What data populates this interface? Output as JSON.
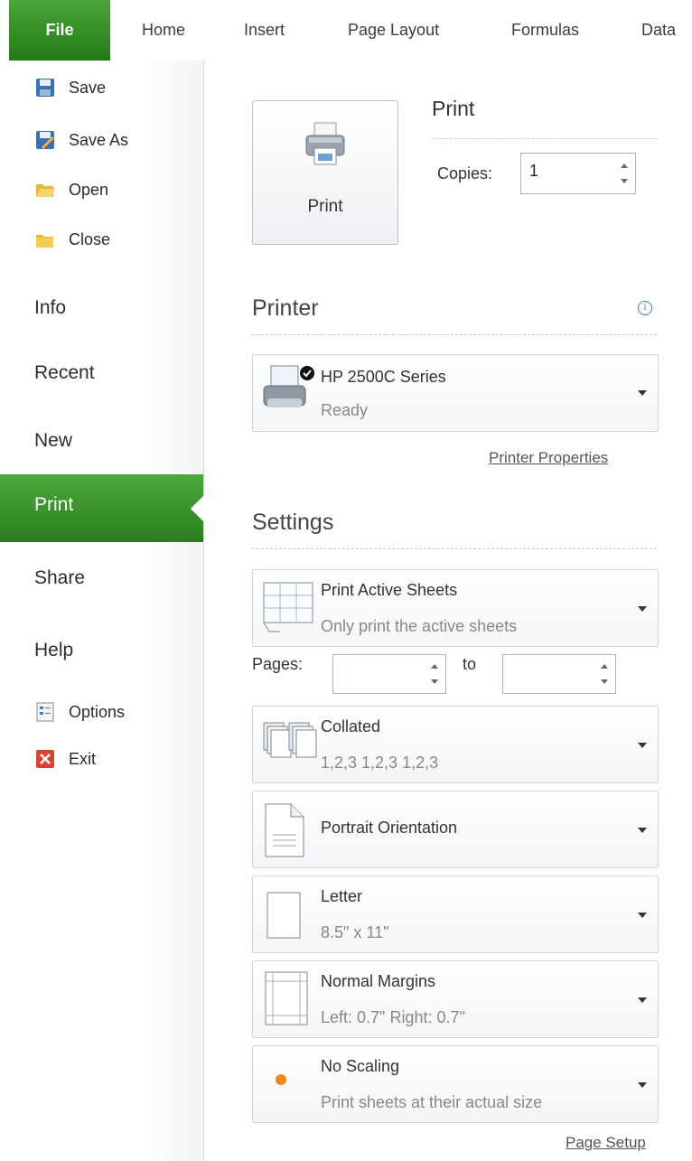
{
  "ribbon": {
    "tabs": [
      "File",
      "Home",
      "Insert",
      "Page Layout",
      "Formulas",
      "Data"
    ]
  },
  "backstage": {
    "commands": [
      {
        "label": "Save",
        "icon": "save-icon"
      },
      {
        "label": "Save As",
        "icon": "save-as-icon"
      },
      {
        "label": "Open",
        "icon": "open-folder-icon"
      },
      {
        "label": "Close",
        "icon": "close-folder-icon"
      }
    ],
    "nav": [
      "Info",
      "Recent",
      "New",
      "Print",
      "Share",
      "Help"
    ],
    "selected_nav": "Print",
    "bottom_commands": [
      {
        "label": "Options",
        "icon": "options-icon"
      },
      {
        "label": "Exit",
        "icon": "exit-icon"
      }
    ]
  },
  "print": {
    "button_label": "Print",
    "heading": "Print",
    "copies_label": "Copies:",
    "copies_value": "1"
  },
  "printer": {
    "heading": "Printer",
    "name": "HP 2500C Series",
    "status": "Ready",
    "properties_link": "Printer Properties"
  },
  "settings": {
    "heading": "Settings",
    "what_to_print": {
      "title": "Print Active Sheets",
      "subtitle": "Only print the active sheets"
    },
    "pages_label": "Pages:",
    "pages_from": "",
    "to_label": "to",
    "pages_to": "",
    "collation": {
      "title": "Collated",
      "subtitle": "1,2,3   1,2,3   1,2,3"
    },
    "orientation": {
      "title": "Portrait Orientation"
    },
    "paper": {
      "title": "Letter",
      "subtitle": "8.5\" x 11\""
    },
    "margins": {
      "title": "Normal Margins",
      "subtitle": "Left: 0.7\"   Right: 0.7\""
    },
    "scaling": {
      "title": "No Scaling",
      "subtitle": "Print sheets at their actual size"
    },
    "page_setup_link": "Page Setup"
  },
  "colors": {
    "file_tab_green": "#2e8a22",
    "selected_nav_green": "#3d9430",
    "accent_blue": "#3b7fd0"
  }
}
